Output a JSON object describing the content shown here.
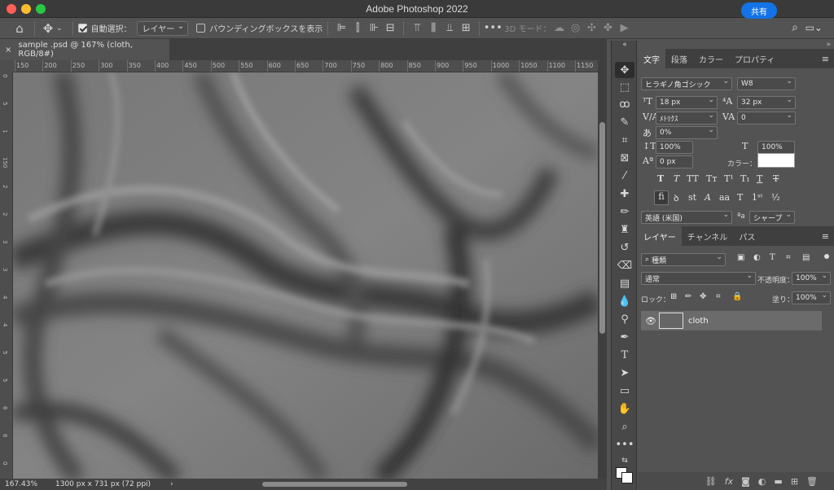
{
  "window": {
    "title": "Adobe Photoshop 2022"
  },
  "options_bar": {
    "auto_select_label": "自動選択：",
    "auto_select_target": "レイヤー",
    "bounding_box_label": "バウンディングボックスを表示",
    "mode_3d_label": "3D モード：",
    "share_label": "共有"
  },
  "document": {
    "tab_title": "sample .psd @ 167% (cloth, RGB/8#)",
    "close_glyph": "×"
  },
  "rulers": {
    "top": [
      "150",
      "200",
      "250",
      "300",
      "350",
      "400",
      "450",
      "500",
      "550",
      "600",
      "650",
      "700",
      "750",
      "800",
      "850",
      "900",
      "950",
      "1000",
      "1050",
      "1100",
      "1150"
    ],
    "left": [
      "0",
      "5",
      "1",
      "150",
      "2",
      "2",
      "3",
      "3",
      "4",
      "4",
      "5",
      "5",
      "6",
      "6",
      "0"
    ]
  },
  "status": {
    "zoom": "167.43%",
    "doc_info": "1300 px x 731 px (72 ppi)"
  },
  "character_panel": {
    "tabs": [
      "文字",
      "段落",
      "カラー",
      "プロパティ"
    ],
    "font_family": "ヒラギノ角ゴシック",
    "font_weight": "W8",
    "font_size": "18 px",
    "leading": "32 px",
    "kerning": "ﾒﾄﾘｸｽ",
    "tracking": "0",
    "tsume": "0%",
    "vertical_scale": "100%",
    "horizontal_scale": "100%",
    "baseline_shift": "0 px",
    "color_label": "カラー：",
    "color_value": "#ffffff",
    "language": "英語 (米国)",
    "aa_label": "ªa",
    "antialias": "シャープ"
  },
  "layers_panel": {
    "tabs": [
      "レイヤー",
      "チャンネル",
      "パス"
    ],
    "filter_label": "種類",
    "blend_mode": "通常",
    "opacity_label": "不透明度：",
    "opacity_value": "100%",
    "lock_label": "ロック：",
    "fill_label": "塗り：",
    "fill_value": "100%",
    "layers": [
      {
        "name": "cloth",
        "visible": true
      }
    ]
  }
}
